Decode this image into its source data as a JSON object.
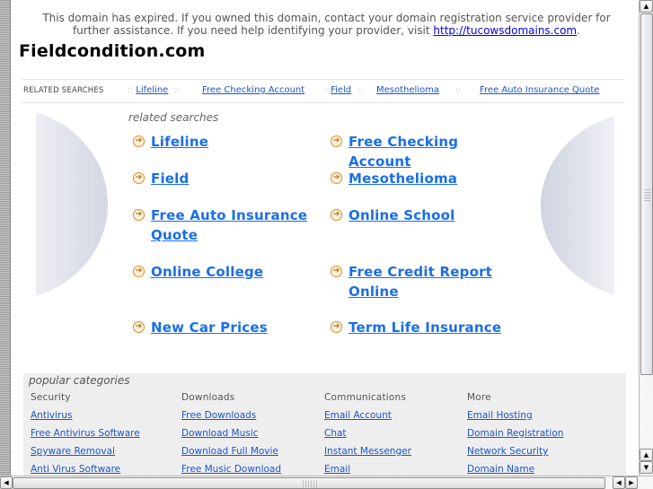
{
  "notice": {
    "text": "This domain has expired. If you owned this domain, contact your domain registration service provider for further assistance. If you need help identifying your provider, visit ",
    "link": "http://tucowsdomains.com",
    "suffix": "."
  },
  "site_title": "Fieldcondition.com",
  "related_bar": {
    "label": "RELATED SEARCHES",
    "separator": "::",
    "items": [
      "Lifeline",
      "Free Checking Account",
      "Field",
      "Mesothelioma",
      "Free Auto Insurance Quote"
    ]
  },
  "related_searches": {
    "heading": "related searches",
    "arrow_glyph": "➔",
    "items": [
      "Lifeline",
      "Free Checking Account",
      "Field",
      "Mesothelioma",
      "Free Auto Insurance Quote",
      "Online School",
      "Online College",
      "Free Credit Report Online",
      "New Car Prices",
      "Term Life Insurance"
    ]
  },
  "popular_categories": {
    "title": "popular categories",
    "columns": [
      {
        "heading": "Security",
        "links": [
          "Antivirus",
          "Free Antivirus Software",
          "Spyware Removal",
          "Anti Virus Software"
        ]
      },
      {
        "heading": "Downloads",
        "links": [
          "Free Downloads",
          "Download Music",
          "Download Full Movie",
          "Free Music Download"
        ]
      },
      {
        "heading": "Communications",
        "links": [
          "Email Account",
          "Chat",
          "Instant Messenger",
          "Email"
        ]
      },
      {
        "heading": "More",
        "links": [
          "Email Hosting",
          "Domain Registration",
          "Network Security",
          "Domain Name"
        ]
      }
    ]
  },
  "scrollbars": {
    "up_glyph": "▲",
    "down_glyph": "▼",
    "left_glyph": "◀",
    "right_glyph": "▶"
  },
  "colors": {
    "link": "#1a6ee8",
    "arrow_accent": "#e08a1e",
    "popular_bg": "#eeeeee"
  }
}
